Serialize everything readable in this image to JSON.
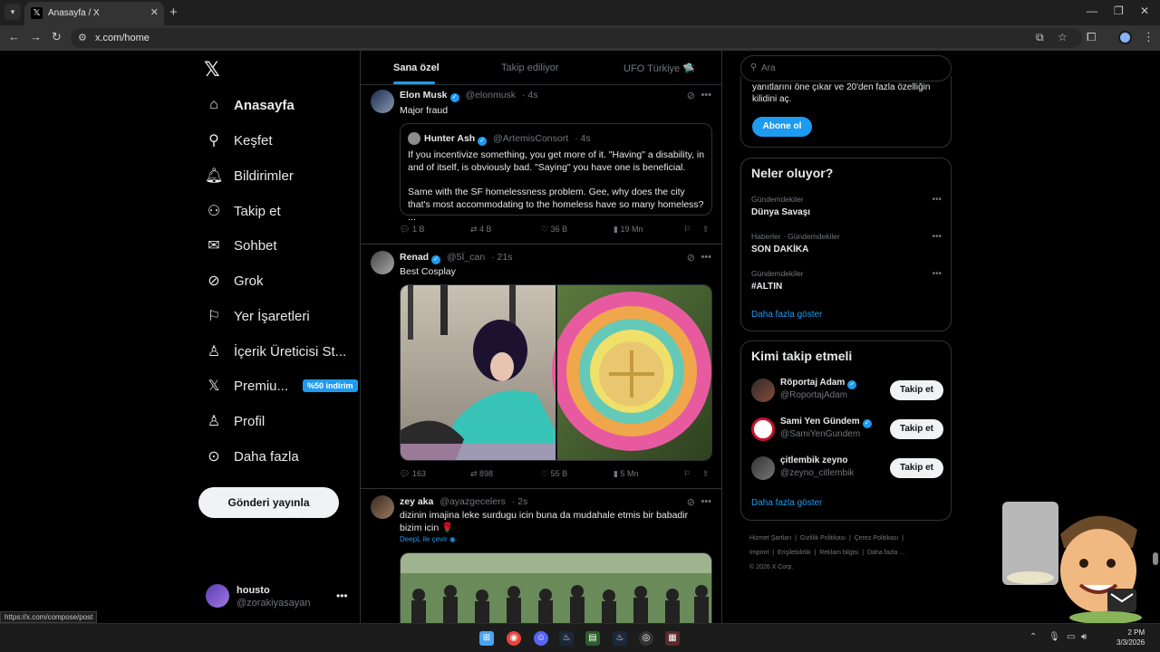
{
  "browser": {
    "tab_title": "Anasayfa / X",
    "url": "x.com/home",
    "status_url": "https://x.com/compose/post"
  },
  "nav": {
    "items": [
      {
        "label": "Anasayfa",
        "icon": "home-icon"
      },
      {
        "label": "Keşfet",
        "icon": "search-icon"
      },
      {
        "label": "Bildirimler",
        "icon": "bell-icon"
      },
      {
        "label": "Takip et",
        "icon": "follow-icon"
      },
      {
        "label": "Sohbet",
        "icon": "mail-icon"
      },
      {
        "label": "Grok",
        "icon": "grok-icon"
      },
      {
        "label": "Yer İşaretleri",
        "icon": "bookmark-icon"
      },
      {
        "label": "İçerik Üreticisi St...",
        "icon": "creator-icon"
      },
      {
        "label": "Premiu...",
        "icon": "x-premium-icon"
      },
      {
        "label": "Profil",
        "icon": "profile-icon"
      },
      {
        "label": "Daha fazla",
        "icon": "more-icon"
      }
    ],
    "premium_badge": "%50 indirim",
    "post_button": "Gönderi yayınla",
    "account": {
      "name": "housto",
      "handle": "@zorakiyasayan"
    }
  },
  "timeline": {
    "tabs": [
      "Sana özel",
      "Takip ediliyor",
      "UFO Türkiye 🛸"
    ],
    "posts": [
      {
        "name": "Elon Musk",
        "handle": "@elonmusk",
        "time": "· 4s",
        "text": "Major fraud",
        "quote": {
          "name": "Hunter Ash",
          "handle": "@ArtemisConsort",
          "time": "· 4s",
          "text1": "If you incentivize something, you get more of it. \"Having\" a disability, in and of itself, is obviously bad. \"Saying\" you have one is beneficial.",
          "text2": "Same with the SF homelessness problem. Gee, why does the city that's most accommodating to the homeless have so many homeless? ..."
        },
        "stats": {
          "replies": "1 B",
          "reposts": "4 B",
          "likes": "36 B",
          "views": "19 Mn"
        }
      },
      {
        "name": "Renad",
        "handle": "@5Ï_can",
        "time": "· 21s",
        "text": "Best Cosplay",
        "stats": {
          "replies": "163",
          "reposts": "898",
          "likes": "55 B",
          "views": "5 Mn"
        }
      },
      {
        "name": "zey aka",
        "handle": "@ayazgecelers",
        "time": "· 2s",
        "text": "dizinin imajina leke surdugu icin buna da mudahale etmis bir babadir bizim icin 🌹",
        "translate": "DeepL ile çevir"
      }
    ]
  },
  "sidebar": {
    "search_placeholder": "Ara",
    "premium_text": "yanıtlarını öne çıkar ve 20'den fazla özelliğin kilidini aç.",
    "subscribe": "Abone ol",
    "trends_title": "Neler oluyor?",
    "trends": [
      {
        "context": "Gündemdekiler",
        "name": "Dünya Savaşı"
      },
      {
        "context": "Haberler · Gündemdekiler",
        "name": "SON DAKİKA"
      },
      {
        "context": "Gündemdekiler",
        "name": "#ALTIN"
      }
    ],
    "show_more": "Daha fazla göster",
    "who_title": "Kimi takip etmeli",
    "who": [
      {
        "name": "Röportaj Adam",
        "handle": "@RoportajAdam",
        "button": "Takip et"
      },
      {
        "name": "Sami Yen Gündem",
        "handle": "@SamiYenGundem",
        "button": "Takip et"
      },
      {
        "name": "çitlembik zeyno",
        "handle": "@zeyno_citlembik",
        "button": "Takip et"
      }
    ],
    "footer": [
      "Hizmet Şartları",
      "Gizlilik Politikası",
      "Çerez Politikası",
      "Imprint",
      "Erişilebilirlik",
      "Reklam bilgisi",
      "Daha fazla ...",
      "© 2026 X Corp."
    ]
  },
  "taskbar": {
    "time": "2 PM",
    "date": "3/3/2026"
  }
}
